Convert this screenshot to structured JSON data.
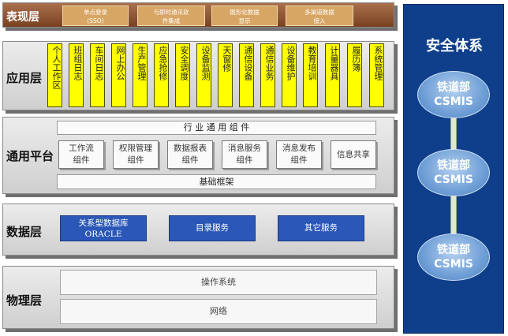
{
  "layers": {
    "presentation": {
      "label": "表现层",
      "items": [
        [
          "单点登录",
          "(SSO)"
        ],
        [
          "与即时通讯软",
          "件集成"
        ],
        [
          "图形化数据",
          "显示"
        ],
        [
          "多渠道数据",
          "接入"
        ]
      ]
    },
    "application": {
      "label": "应用层",
      "items": [
        "个人工作区",
        "班组日志",
        "车间日志",
        "网上办公",
        "生产管理",
        "应急抢修",
        "安全调度",
        "设备监测",
        "天窗修",
        "通信设备",
        "通信业务",
        "设备维护",
        "教育培训",
        "计量器具",
        "履历簿",
        "系统管理"
      ]
    },
    "platform": {
      "label": "通用平台",
      "top_bar": "行 业 通 用 组 件",
      "components": [
        [
          "工作流",
          "组件"
        ],
        [
          "权限管理",
          "组件"
        ],
        [
          "数据报表",
          "组件"
        ],
        [
          "消息服务",
          "组件"
        ],
        [
          "消息发布",
          "组件"
        ],
        [
          "信息共享"
        ]
      ],
      "bottom_bar": "基础框架"
    },
    "data": {
      "label": "数据层",
      "items": [
        [
          "关系型数据库",
          "ORACLE"
        ],
        [
          "目录服务"
        ],
        [
          "其它服务"
        ]
      ]
    },
    "physical": {
      "label": "物理层",
      "items": [
        "操作系统",
        "网络"
      ]
    }
  },
  "security": {
    "title": "安全体系",
    "nodes": [
      [
        "铁道部",
        "CSMIS"
      ],
      [
        "铁道部",
        "CSMIS"
      ],
      [
        "铁道部",
        "CSMIS"
      ]
    ]
  },
  "colors": {
    "presentation_bg": "#8a5030",
    "app_box": "#ffff00",
    "data_box": "#2a57b8",
    "security_bg": "#0f3f8a"
  }
}
